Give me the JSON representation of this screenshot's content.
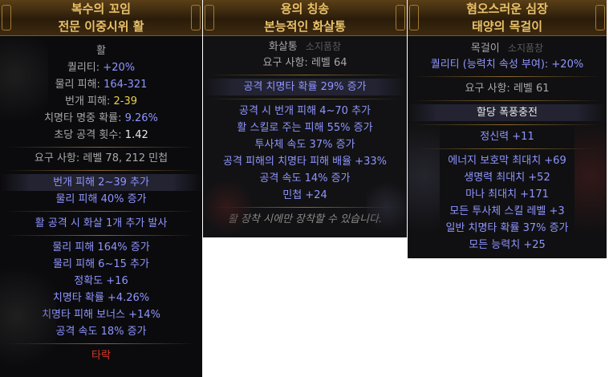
{
  "tooltips": [
    {
      "title1": "복수의 꼬임",
      "title2": "전문 이중시위 활",
      "base": "활",
      "quality_label": "퀄리티:",
      "quality_value": "+20%",
      "phys_label": "물리 피해:",
      "phys_value": "164-321",
      "light_label": "번개 피해:",
      "light_value": "2-39",
      "crit_label": "치명타 명중 확률:",
      "crit_value": "9.26%",
      "aps_label": "초당 공격 횟수:",
      "aps_value": "1.42",
      "req": "요구 사항: 레벨 78, 212 민첩",
      "enchants": [
        "번개 피해 2~39 추가",
        "물리 피해 40% 증가"
      ],
      "implicit": "활 공격 시 화살 1개 추가 발사",
      "mods": [
        "물리 피해 164% 증가",
        "물리 피해 6~15 추가",
        "정확도 +16",
        "치명타 확률 +4.26%",
        "치명타 피해 보너스 +14%",
        "공격 속도 18% 증가"
      ],
      "footer": "타락"
    },
    {
      "title1": "용의 칭송",
      "title2": "본능적인 화살통",
      "slot_tag": "소지품창",
      "base": "화살통",
      "req": "요구 사항: 레벨 64",
      "implicit": "공격 치명타 확률 29% 증가",
      "mods": [
        "공격 시 번개 피해 4~70 추가",
        "활 스킬로 주는 피해 55% 증가",
        "투사체 속도 37% 증가",
        "공격 피해의 치명타 피해 배율 +33%",
        "공격 속도 14% 증가",
        "민첩 +24"
      ],
      "footer": "활 장착 시에만 장착할 수 있습니다."
    },
    {
      "title1": "혐오스러운 심장",
      "title2": "태양의 목걸이",
      "slot_tag": "소지품창",
      "base": "목걸이",
      "quality": "퀄리티 (능력치 속성 부여): +20%",
      "req": "요구 사항: 레벨 61",
      "enchant": "할당 폭풍충전",
      "implicit": "정신력 +11",
      "mods": [
        "에너지 보호막 최대치 +69",
        "생명력 최대치 +52",
        "마나 최대치 +171",
        "모든 투사체 스킬 레벨 +3",
        "일반 치명타 확률 37% 증가",
        "모든 능력치 +25"
      ]
    }
  ]
}
